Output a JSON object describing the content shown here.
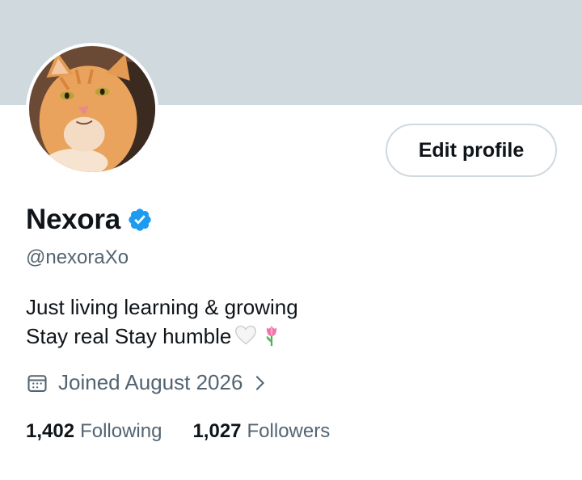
{
  "profile": {
    "display_name": "Nexora",
    "handle": "@nexoraXo",
    "verified_icon": "verified-badge-icon",
    "edit_button_label": "Edit profile",
    "bio_line_1": "Just living learning & growing",
    "bio_line_2": "Stay real Stay humble",
    "bio_emojis": [
      "white-heart",
      "tulip"
    ],
    "joined_text": "Joined August 2026",
    "joined_icon": "calendar-icon",
    "following_count": "1,402",
    "following_label": "Following",
    "followers_count": "1,027",
    "followers_label": "Followers"
  },
  "colors": {
    "banner": "#cfd9de",
    "verified_blue": "#1d9bf0",
    "secondary_text": "#536471",
    "primary_text": "#0f1419"
  }
}
